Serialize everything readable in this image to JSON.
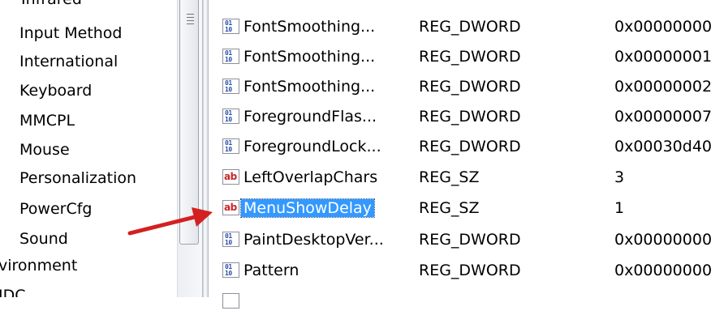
{
  "tree": {
    "items": [
      {
        "label": "Input Method"
      },
      {
        "label": "International"
      },
      {
        "label": "Keyboard"
      },
      {
        "label": "MMCPL"
      },
      {
        "label": "Mouse"
      },
      {
        "label": "Personalization"
      },
      {
        "label": "PowerCfg"
      },
      {
        "label": "Sound"
      },
      {
        "label": "vironment"
      },
      {
        "label": "IDC"
      }
    ],
    "clipped_top_label": "Infrared"
  },
  "values": [
    {
      "name": "FontSmoothing...",
      "type": "REG_DWORD",
      "data": "0x00000000",
      "icon": "binary-value-icon"
    },
    {
      "name": "FontSmoothing...",
      "type": "REG_DWORD",
      "data": "0x00000001",
      "icon": "binary-value-icon"
    },
    {
      "name": "FontSmoothing...",
      "type": "REG_DWORD",
      "data": "0x00000002",
      "icon": "binary-value-icon"
    },
    {
      "name": "ForegroundFlas...",
      "type": "REG_DWORD",
      "data": "0x00000007",
      "icon": "binary-value-icon"
    },
    {
      "name": "ForegroundLock...",
      "type": "REG_DWORD",
      "data": "0x00030d40",
      "icon": "binary-value-icon"
    },
    {
      "name": "LeftOverlapChars",
      "type": "REG_SZ",
      "data": "3",
      "icon": "string-value-icon"
    },
    {
      "name": "MenuShowDelay",
      "type": "REG_SZ",
      "data": "1",
      "icon": "string-value-icon",
      "selected": true
    },
    {
      "name": "PaintDesktopVer...",
      "type": "REG_DWORD",
      "data": "0x00000000",
      "icon": "binary-value-icon"
    },
    {
      "name": "Pattern",
      "type": "REG_DWORD",
      "data": "0x00000000",
      "icon": "binary-value-icon"
    }
  ],
  "icon_glyphs": {
    "binary_top": "01",
    "binary_bottom": "10",
    "string": "ab"
  },
  "colors": {
    "selection": "#3399ff",
    "arrow": "#d42020",
    "string_icon": "#c8262a",
    "binary_icon": "#2a4ea8"
  }
}
